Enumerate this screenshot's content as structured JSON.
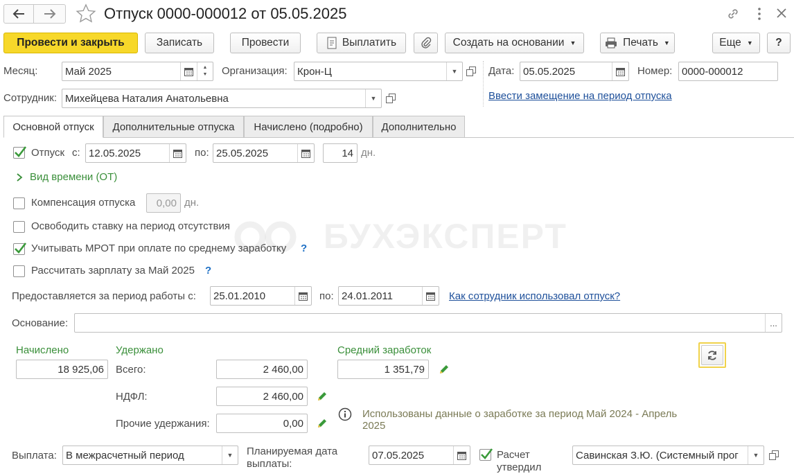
{
  "header": {
    "title": "Отпуск 0000-000012 от 05.05.2025"
  },
  "toolbar": {
    "post_close": "Провести и закрыть",
    "save": "Записать",
    "post": "Провести",
    "pay": "Выплатить",
    "create_based": "Создать на основании",
    "print": "Печать",
    "more": "Еще",
    "help": "?"
  },
  "form": {
    "month_label": "Месяц:",
    "month_value": "Май 2025",
    "org_label": "Организация:",
    "org_value": "Крон-Ц",
    "date_label": "Дата:",
    "date_value": "05.05.2025",
    "number_label": "Номер:",
    "number_value": "0000-000012",
    "employee_label": "Сотрудник:",
    "employee_value": "Михейцева Наталия Анатольевна",
    "substitute_link": "Ввести замещение на период отпуска"
  },
  "tabs": [
    "Основной отпуск",
    "Дополнительные отпуска",
    "Начислено (подробно)",
    "Дополнительно"
  ],
  "vacation": {
    "label": "Отпуск",
    "from_label": "с:",
    "from_value": "12.05.2025",
    "to_label": "по:",
    "to_value": "25.05.2025",
    "days_value": "14",
    "days_unit": "дн.",
    "time_type": "Вид времени (ОТ)",
    "compensation_label": "Компенсация отпуска",
    "compensation_value": "0,00",
    "compensation_unit": "дн.",
    "release_rate_label": "Освободить ставку на период отсутствия",
    "mrot_label": "Учитывать МРОТ при оплате по среднему заработку",
    "mrot_help": "?",
    "calc_salary_label": "Рассчитать зарплату за Май 2025",
    "calc_salary_help": "?",
    "period_label": "Предоставляется за период работы с:",
    "period_from": "25.01.2010",
    "period_to_label": "по:",
    "period_to": "24.01.2011",
    "usage_link": "Как сотрудник использовал отпуск?",
    "basis_label": "Основание:",
    "basis_value": "",
    "basis_button": "..."
  },
  "totals": {
    "accrued_label": "Начислено",
    "accrued_value": "18 925,06",
    "withheld_label": "Удержано",
    "total_label": "Всего:",
    "total_value": "2 460,00",
    "ndfl_label": "НДФЛ:",
    "ndfl_value": "2 460,00",
    "other_label": "Прочие удержания:",
    "other_value": "0,00",
    "avg_label": "Средний заработок",
    "avg_value": "1 351,79",
    "info_text_1": "Использованы данные о заработке за период Май 2024 - Апрель",
    "info_text_2": "2025"
  },
  "payment": {
    "label": "Выплата:",
    "value": "В межрасчетный период",
    "planned_label_1": "Планируемая дата",
    "planned_label_2": "выплаты:",
    "planned_value": "07.05.2025",
    "approved_label_1": "Расчет",
    "approved_label_2": "утвердил",
    "approver_value": "Савинская З.Ю. (Системный прог"
  },
  "watermark": "БУХЭКСПЕРТ",
  "colors": {
    "accent_yellow": "#f7d82a",
    "green_text": "#3a8f3a",
    "link_blue": "#1d4f9a",
    "check_green": "#3a9a3a"
  }
}
